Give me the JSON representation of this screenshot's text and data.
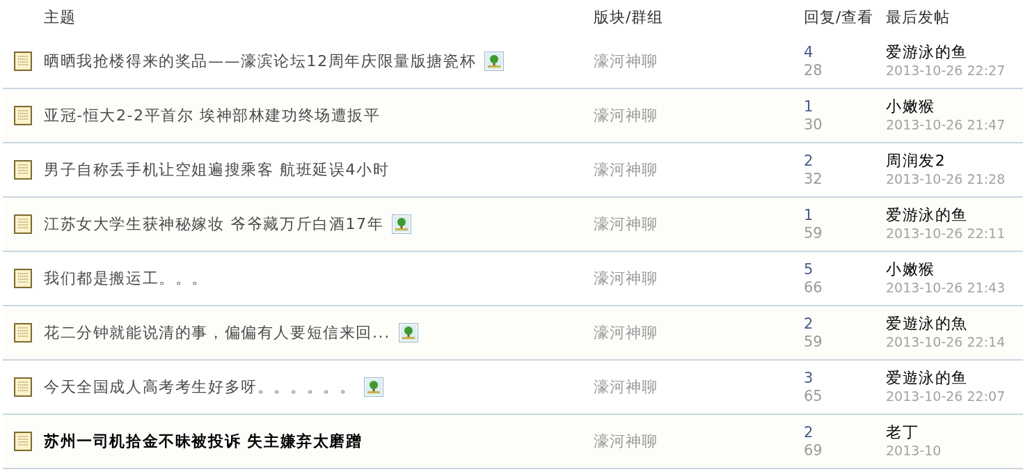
{
  "table": {
    "columns": [
      {
        "label": "主题"
      },
      {
        "label": "版块/群组"
      },
      {
        "label": "回复/查看"
      },
      {
        "label": "最后发帖"
      }
    ],
    "rows": [
      {
        "title": "晒晒我抢楼得来的奖品——濠滨论坛12周年庆限量版搪瓷杯",
        "has_image": true,
        "bold": false,
        "board": "濠河神聊",
        "replies": "4",
        "views": "28",
        "last_author": "爱游泳的鱼",
        "last_time": "2013-10-26 22:27"
      },
      {
        "title": "亚冠-恒大2-2平首尔 埃神部林建功终场遭扳平",
        "has_image": false,
        "bold": false,
        "board": "濠河神聊",
        "replies": "1",
        "views": "30",
        "last_author": "小嫩猴",
        "last_time": "2013-10-26 21:47"
      },
      {
        "title": "男子自称丢手机让空姐遍搜乘客 航班延误4小时",
        "has_image": false,
        "bold": false,
        "board": "濠河神聊",
        "replies": "2",
        "views": "32",
        "last_author": "周润发2",
        "last_time": "2013-10-26 21:28"
      },
      {
        "title": "江苏女大学生获神秘嫁妆 爷爷藏万斤白酒17年",
        "has_image": true,
        "bold": false,
        "board": "濠河神聊",
        "replies": "1",
        "views": "59",
        "last_author": "爱游泳的鱼",
        "last_time": "2013-10-26 22:11"
      },
      {
        "title": "我们都是搬运工。。。",
        "has_image": false,
        "bold": false,
        "board": "濠河神聊",
        "replies": "5",
        "views": "66",
        "last_author": "小嫩猴",
        "last_time": "2013-10-26 21:43"
      },
      {
        "title": "花二分钟就能说清的事，偏偏有人要短信来回...",
        "has_image": true,
        "bold": false,
        "board": "濠河神聊",
        "replies": "2",
        "views": "59",
        "last_author": "爱遊泳的魚",
        "last_time": "2013-10-26 22:14"
      },
      {
        "title": "今天全国成人高考考生好多呀。。。。。。",
        "has_image": true,
        "bold": false,
        "board": "濠河神聊",
        "replies": "3",
        "views": "65",
        "last_author": "爱遊泳的鱼",
        "last_time": "2013-10-26 22:07"
      },
      {
        "title": "苏州一司机拾金不昧被投诉 失主嫌弃太磨蹭",
        "has_image": false,
        "bold": true,
        "board": "濠河神聊",
        "replies": "2",
        "views": "69",
        "last_author": "老丁",
        "last_time": "2013-10"
      }
    ]
  }
}
